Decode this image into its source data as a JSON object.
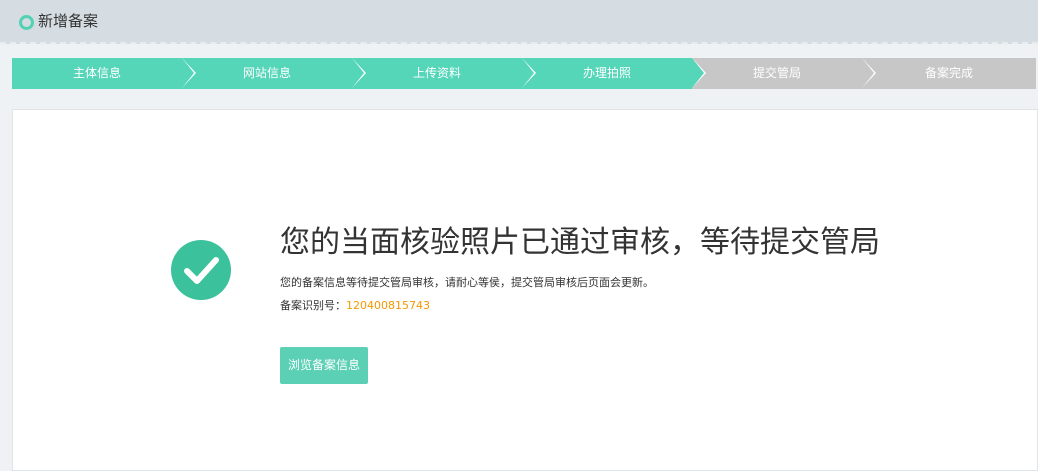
{
  "header": {
    "title": "新增备案"
  },
  "steps": [
    {
      "label": "主体信息",
      "state": "active"
    },
    {
      "label": "网站信息",
      "state": "active"
    },
    {
      "label": "上传资料",
      "state": "active"
    },
    {
      "label": "办理拍照",
      "state": "active"
    },
    {
      "label": "提交管局",
      "state": "inactive"
    },
    {
      "label": "备案完成",
      "state": "inactive"
    }
  ],
  "result": {
    "icon": "check-circle-icon",
    "headline": "您的当面核验照片已通过审核，等待提交管局",
    "description": "您的备案信息等待提交管局审核，请耐心等侯，提交管局审核后页面会更新。",
    "id_label": "备案识别号：",
    "id_value": "120400815743",
    "browse_button": "浏览备案信息"
  },
  "colors": {
    "accent": "#55d6b8",
    "inactive": "#c7c7c7",
    "success": "#3cc19d",
    "id_highlight": "#f39800"
  }
}
